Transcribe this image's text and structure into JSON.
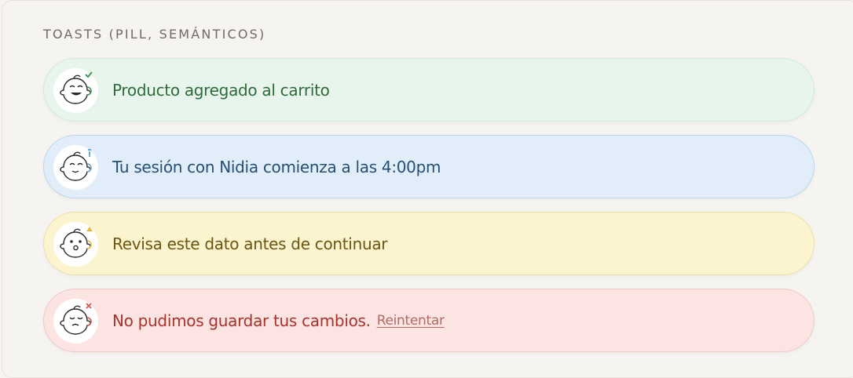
{
  "section_title": "TOASTS (PILL, SEMÁNTICOS)",
  "toasts": [
    {
      "variant": "success",
      "message": "Producto agregado al carrito",
      "badge_color": "#3f9a57",
      "badge_icon": "check-icon"
    },
    {
      "variant": "info",
      "message": "Tu sesión con Nidia comienza a las 4:00pm",
      "badge_color": "#6aa7d6",
      "badge_icon": "info-icon"
    },
    {
      "variant": "warning",
      "message": "Revisa este dato antes de continuar",
      "badge_color": "#e8b93a",
      "badge_icon": "warning-icon"
    },
    {
      "variant": "error",
      "message": "No pudimos guardar tus cambios.",
      "action": "Reintentar",
      "badge_color": "#d9534f",
      "badge_icon": "x-icon"
    }
  ]
}
